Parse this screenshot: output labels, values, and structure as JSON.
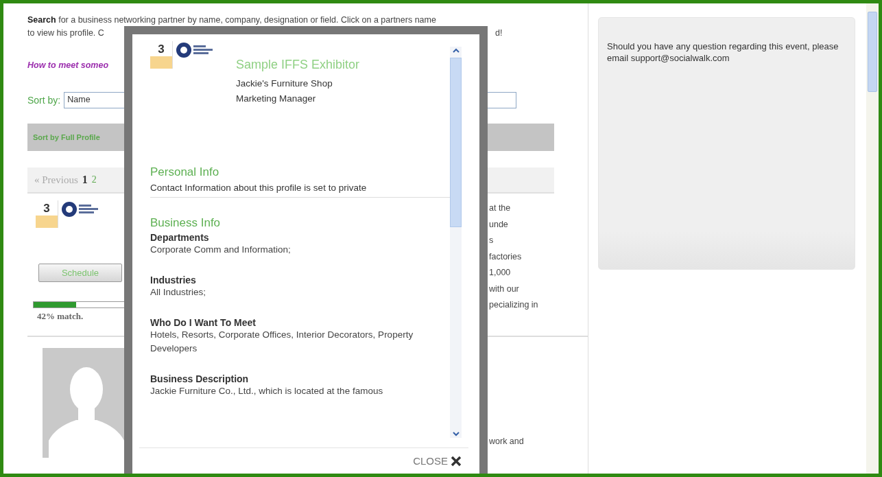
{
  "intro": {
    "text": "**Search** for a business networking partner by name, company, designation or field. Click on a partners name",
    "line2_left": "to view his profile. C",
    "line2_right": "d!"
  },
  "help_link": "How to meet someo",
  "sort": {
    "label": "Sort by:",
    "value": "Name"
  },
  "sort_bar": "Sort by Full Profile",
  "pager": {
    "previous": "« Previous",
    "pages": [
      {
        "label": "1",
        "selected": true
      },
      {
        "label": "2",
        "selected": false
      }
    ]
  },
  "result": {
    "badge_years": "3",
    "button": "Schedule",
    "match": {
      "level": 0.42,
      "label": "42% match."
    },
    "description_fragments": [
      "at the",
      "unde",
      "s",
      "factories",
      "1,000",
      "with our",
      "pecializing in"
    ]
  },
  "second_result": {
    "fragment": "work and"
  },
  "help_panel": {
    "text": "Should you have any question regarding this event, please email support@socialwalk.com"
  },
  "modal": {
    "badge_years": "3",
    "name": "Sample IFFS Exhibitor",
    "company": "Jackie's Furniture Shop",
    "title": "Marketing Manager",
    "sections": [
      {
        "heading": "Personal Info",
        "kind": "note",
        "text": "Contact Information about this profile is set to private"
      },
      {
        "heading": "Business Info",
        "kind": "fields",
        "fields": [
          {
            "label": "Departments",
            "value": "Corporate Comm and Information;"
          },
          {
            "label": "Industries",
            "value": "All Industries;"
          },
          {
            "label": "Who Do I Want To Meet",
            "value": "Hotels, Resorts, Corporate Offices, Interior Decorators, Property Developers"
          },
          {
            "label": "Business Description",
            "value": "Jackie Furniture Co., Ltd., which is located at the famous"
          }
        ]
      }
    ],
    "close": "CLOSE"
  }
}
